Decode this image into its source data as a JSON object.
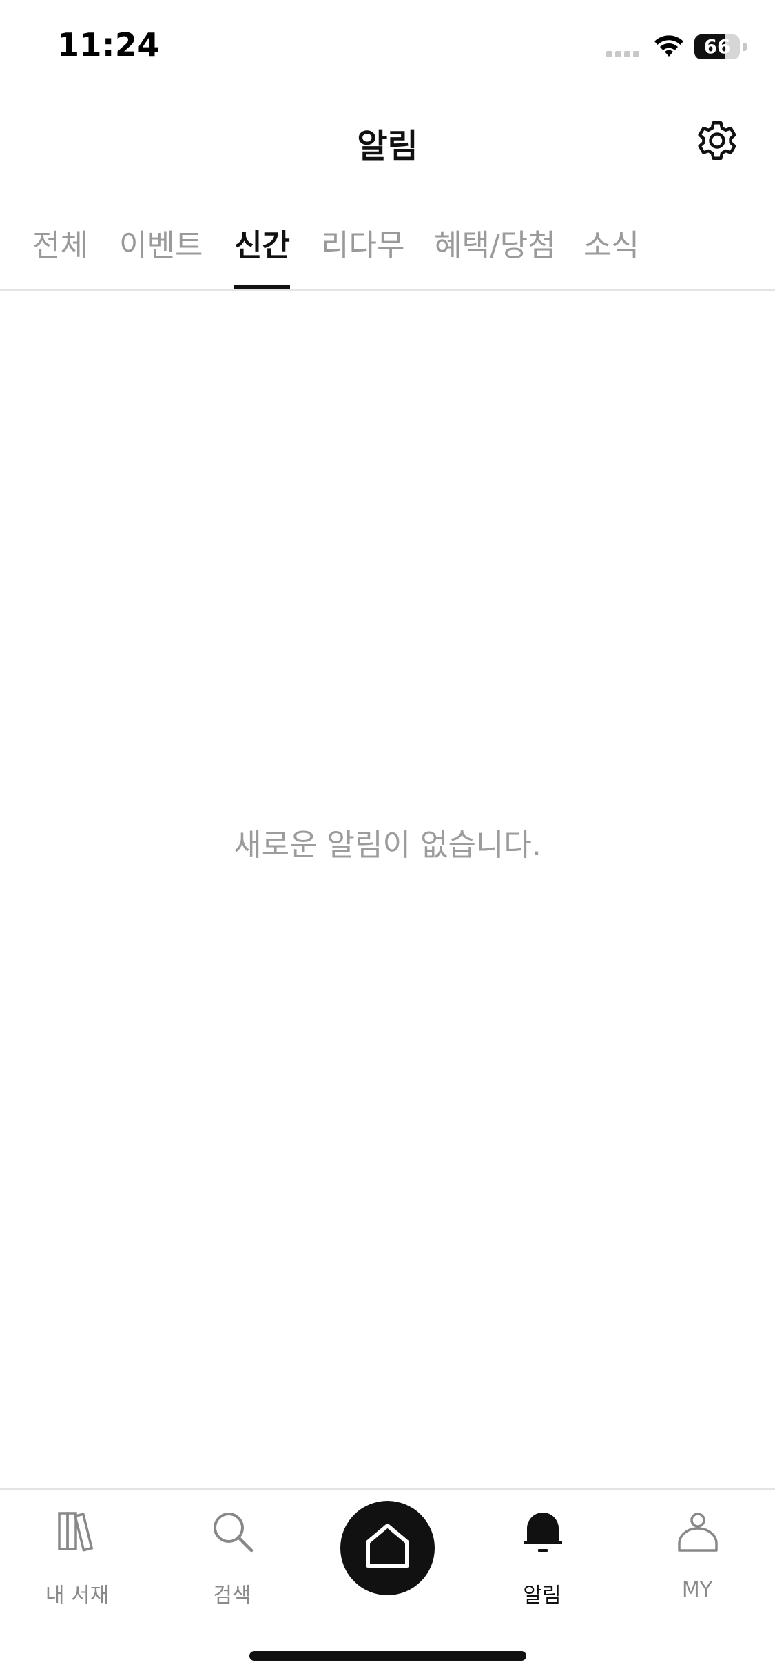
{
  "status_bar": {
    "time": "11:24",
    "battery_level": "66",
    "battery_fraction": 0.66
  },
  "header": {
    "title": "알림",
    "settings_icon": "gear-icon"
  },
  "tabs": [
    {
      "label": "전체",
      "active": false
    },
    {
      "label": "이벤트",
      "active": false
    },
    {
      "label": "신간",
      "active": true
    },
    {
      "label": "리다무",
      "active": false
    },
    {
      "label": "혜택/당첨",
      "active": false
    },
    {
      "label": "소식",
      "active": false
    }
  ],
  "empty_state": {
    "message": "새로운 알림이 없습니다."
  },
  "bottom_nav": {
    "items": [
      {
        "label": "내 서재",
        "icon": "books-icon",
        "active": false
      },
      {
        "label": "검색",
        "icon": "search-icon",
        "active": false
      },
      {
        "label": "",
        "icon": "home-icon",
        "active": false
      },
      {
        "label": "알림",
        "icon": "bell-icon",
        "active": true
      },
      {
        "label": "MY",
        "icon": "person-icon",
        "active": false
      }
    ]
  },
  "colors": {
    "text_primary": "#111111",
    "text_secondary": "#9a9a9a",
    "divider": "#e4e4e4",
    "accent": "#111111"
  }
}
